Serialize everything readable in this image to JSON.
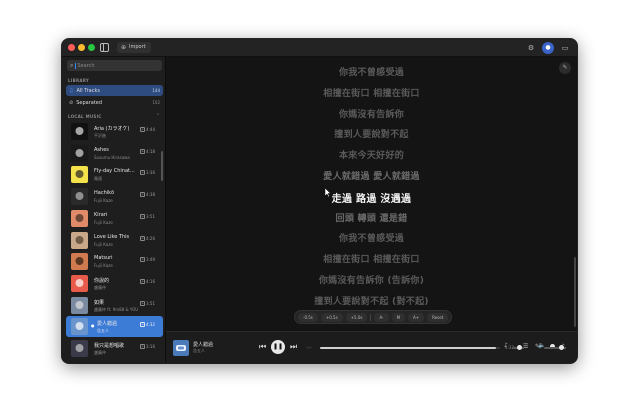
{
  "window": {
    "import_label": "Import",
    "icons": [
      "sidebar-toggle-icon",
      "import-icon",
      "gear-icon",
      "user-icon",
      "display-icon"
    ]
  },
  "sidebar": {
    "search": {
      "placeholder": "Search",
      "value": ""
    },
    "library_label": "LIBRARY",
    "library": [
      {
        "label": "All Tracks",
        "count": "144",
        "icon": "music-icon",
        "active": true
      },
      {
        "label": "Separated",
        "count": "102",
        "icon": "separate-icon",
        "active": false
      }
    ],
    "local_label": "LOCAL MUSIC",
    "tracks": [
      {
        "title": "Aria (カラオケ)",
        "artist": "平沢進",
        "duration": "4:44",
        "art_bg": "#111111",
        "art_fg": "#e6e6e6"
      },
      {
        "title": "Ashes",
        "artist": "Susumu Hirasawa",
        "duration": "4:18",
        "art_bg": "#1a1a1a",
        "art_fg": "#dcdcdc"
      },
      {
        "title": "Fly-day Chinat...",
        "artist": "雅邁",
        "duration": "3:36",
        "art_bg": "#f3e24a",
        "art_fg": "#222222"
      },
      {
        "title": "Hachikō",
        "artist": "Fujii Kaze",
        "duration": "4:38",
        "art_bg": "#2a2a2a",
        "art_fg": "#bbbbbb"
      },
      {
        "title": "Kirari",
        "artist": "Fujii Kaze",
        "duration": "3:51",
        "art_bg": "#e08a6a",
        "art_fg": "#3a2a20"
      },
      {
        "title": "Love Like This",
        "artist": "Fujii Kaze",
        "duration": "4:26",
        "art_bg": "#c9a88a",
        "art_fg": "#4a3a2a"
      },
      {
        "title": "Matsuri",
        "artist": "Fujii Kaze",
        "duration": "3:49",
        "art_bg": "#d07a50",
        "art_fg": "#2a1a10"
      },
      {
        "title": "你說的",
        "artist": "盧廣仲",
        "duration": "4:16",
        "art_bg": "#e85a4a",
        "art_fg": "#ffffff"
      },
      {
        "title": "如果",
        "artist": "盧廣仲 ft. 9m88 & YOUNG1000",
        "duration": "3:51",
        "art_bg": "#7a8aa0",
        "art_fg": "#e0e0e0"
      },
      {
        "title": "愛人錯過",
        "artist": "告五人",
        "duration": "4:32",
        "art_bg": "#6a94cc",
        "art_fg": "#ffffff",
        "active": true
      },
      {
        "title": "我只是想唱歌",
        "artist": "盧廣仲",
        "duration": "3:16",
        "art_bg": "#3a3a4a",
        "art_fg": "#cccccc"
      }
    ]
  },
  "lyrics": {
    "lines": [
      "你我不曾感受過",
      "相撞在街口 相撞在街口",
      "你媽沒有告訴你",
      "撞到人要說對不起",
      "本來今天好好的",
      "愛人就錯過 愛人就錯過",
      "走過 路過 沒遇過",
      "回頭 轉頭 還是錯",
      "你我不曾感受過",
      "相撞在街口 相撞在街口",
      "你媽沒有告訴你 (告訴你)",
      "撞到人要說對不起 (對不起)"
    ],
    "current_index": 6
  },
  "offset_bar": {
    "buttons": [
      "-0.5s",
      "+0.5s",
      "+5.0s",
      "A-",
      "M",
      "A+",
      "Reset"
    ]
  },
  "player": {
    "title": "愛人錯過",
    "artist": "告五人",
    "elapsed": "-:--",
    "total": "4:32",
    "progress": 0.98,
    "lyric_volume": 0.6,
    "vocal_volume": 0.55,
    "volume": 0.7
  }
}
